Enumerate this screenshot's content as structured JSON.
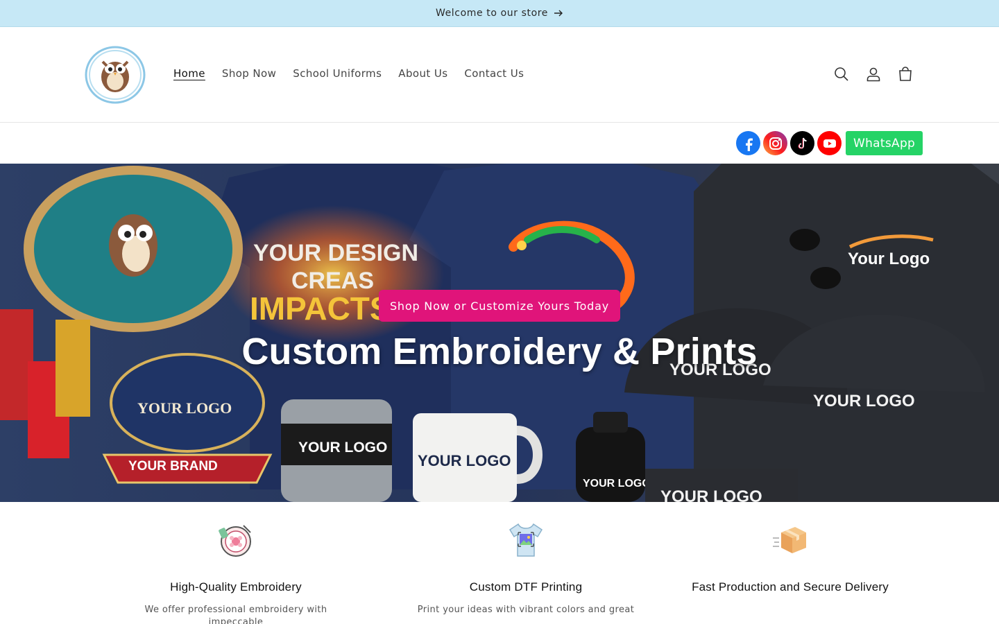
{
  "announcement": {
    "text": "Welcome to our store"
  },
  "header": {
    "nav": [
      {
        "label": "Home",
        "active": true
      },
      {
        "label": "Shop Now",
        "active": false
      },
      {
        "label": "School Uniforms",
        "active": false
      },
      {
        "label": "About Us",
        "active": false
      },
      {
        "label": "Contact Us",
        "active": false
      }
    ],
    "icons": [
      "search-icon",
      "account-icon",
      "cart-icon"
    ]
  },
  "social": {
    "icons": [
      "facebook-icon",
      "instagram-icon",
      "tiktok-icon",
      "youtube-icon"
    ],
    "whatsapp_label": "WhatsApp",
    "whatsapp_color": "#25d366"
  },
  "hero": {
    "button_label": "Shop Now or Customize Yours Today",
    "button_color": "#e0147a",
    "title": "Custom Embroidery & Prints",
    "image_texts": {
      "headline_1": "YOUR DESIGN",
      "headline_2": "CREAS",
      "headline_3": "IMPACTS",
      "shirt_logo": "Your Logo",
      "patch_logo": "YOUR LOGO",
      "brand_badge": "YOUR BRAND",
      "tumbler_logo": "YOUR LOGO",
      "mug_logo": "YOUR LOGO",
      "bottle_logo": "YOUR LOGO",
      "cap_logo_1": "YOUR LOGO",
      "cap_logo_2": "YOUR LOGO",
      "bag_logo": "YOUR LOGO"
    }
  },
  "features": [
    {
      "icon": "embroidery-hoop-icon",
      "title": "High-Quality Embroidery",
      "text": "We offer professional embroidery with impeccable"
    },
    {
      "icon": "tshirt-print-icon",
      "title": "Custom DTF Printing",
      "text": "Print your ideas with vibrant colors and great"
    },
    {
      "icon": "delivery-box-icon",
      "title": "Fast Production and Secure Delivery",
      "text": ""
    }
  ],
  "colors": {
    "announcement_bg": "#c6e8f6",
    "accent": "#e0147a"
  }
}
